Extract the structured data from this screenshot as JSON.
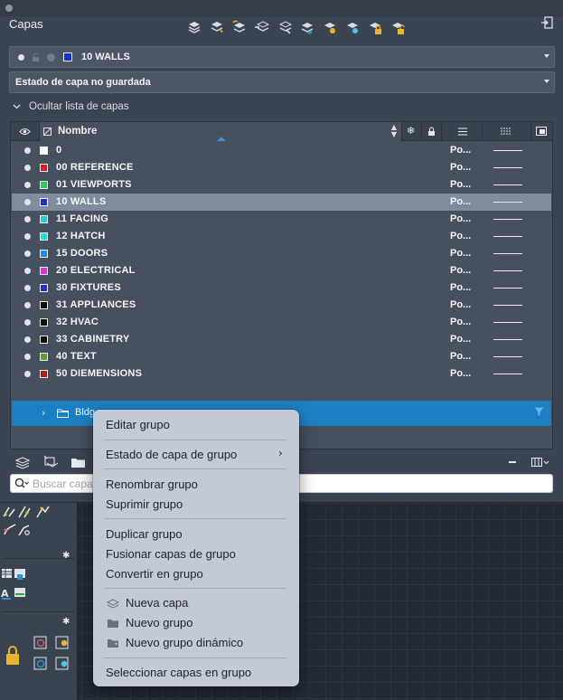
{
  "palette": {
    "title": "Capas"
  },
  "current_layer": {
    "name": "10 WALLS",
    "color": "#1530d8"
  },
  "layer_state": {
    "value": "Estado de capa no guardada"
  },
  "toggle_list": {
    "label": "Ocultar lista de capas"
  },
  "table": {
    "column_name": "Nombre",
    "rows": [
      {
        "name": "0",
        "color": "#ffffff",
        "plot": "Po...",
        "selected": false
      },
      {
        "name": "00 REFERENCE",
        "color": "#e01b1b",
        "plot": "Po...",
        "selected": false
      },
      {
        "name": "01 VIEWPORTS",
        "color": "#22d14b",
        "plot": "Po...",
        "selected": false
      },
      {
        "name": "10 WALLS",
        "color": "#1530d8",
        "plot": "Po...",
        "selected": true
      },
      {
        "name": "11 FACING",
        "color": "#19d3d8",
        "plot": "Po...",
        "selected": false
      },
      {
        "name": "12 HATCH",
        "color": "#19e0e8",
        "plot": "Po...",
        "selected": false
      },
      {
        "name": "15 DOORS",
        "color": "#1a8ef0",
        "plot": "Po...",
        "selected": false
      },
      {
        "name": "20 ELECTRICAL",
        "color": "#e22be0",
        "plot": "Po...",
        "selected": false
      },
      {
        "name": "30 FIXTURES",
        "color": "#1f2fe0",
        "plot": "Po...",
        "selected": false
      },
      {
        "name": "31 APPLIANCES",
        "color": "#0b0b0b",
        "plot": "Po...",
        "selected": false
      },
      {
        "name": "32 HVAC",
        "color": "#0b0b0b",
        "plot": "Po...",
        "selected": false
      },
      {
        "name": "33 CABINETRY",
        "color": "#0b0b0b",
        "plot": "Po...",
        "selected": false
      },
      {
        "name": "40 TEXT",
        "color": "#5aa325",
        "plot": "Po...",
        "selected": false
      },
      {
        "name": "50 DIEMENSIONS",
        "color": "#b51d1d",
        "plot": "Po...",
        "selected": false
      }
    ]
  },
  "group": {
    "label": "Bldg"
  },
  "search": {
    "placeholder": "Buscar capa"
  },
  "context_menu": {
    "edit_group": "Editar grupo",
    "group_layer_state": "Estado de capa de grupo",
    "rename_group": "Renombrar grupo",
    "delete_group": "Suprimir grupo",
    "duplicate_group": "Duplicar grupo",
    "merge_group_layers": "Fusionar capas de grupo",
    "convert_to_group": "Convertir en grupo",
    "new_layer": "Nueva capa",
    "new_group": "Nuevo grupo",
    "new_dynamic_group": "Nuevo grupo dinámico",
    "select_layers_in_group": "Seleccionar capas en grupo"
  }
}
